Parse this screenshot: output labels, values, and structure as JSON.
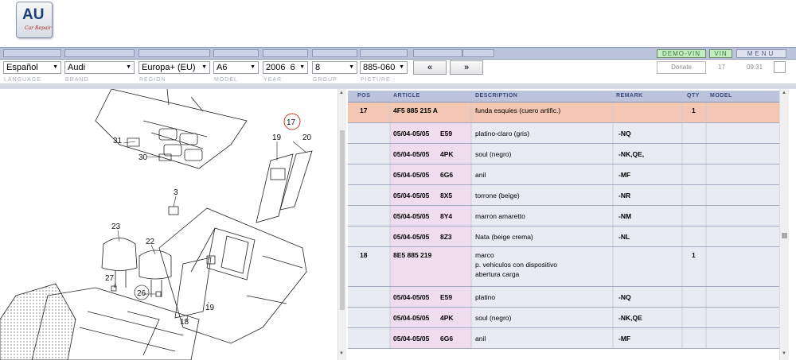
{
  "logo": {
    "big": "AU",
    "small": "Car Repair"
  },
  "topbar": {
    "demo_vin": "DEMO-VIN",
    "vin": "VIN",
    "menu": "MENU"
  },
  "filters": {
    "language": "Español",
    "brand": "Audi",
    "region": "Europa+ (EU)",
    "model": "A6",
    "year": "2006  6",
    "group": "8",
    "picture": "885-060",
    "prev": "«",
    "next": "»",
    "donate": "Donate",
    "page_current": "17",
    "page_time": "09:31"
  },
  "labels": {
    "language": "LANGUAGE",
    "brand": "BRAND",
    "region": "REGION",
    "model": "MODEL",
    "year": "YEAR",
    "group": "GROUP",
    "picture": "PICTURE"
  },
  "diagram": {
    "callouts": [
      "31",
      "30",
      "3",
      "23",
      "22",
      "27",
      "26",
      "18",
      "19",
      "20",
      "17",
      "19"
    ]
  },
  "table": {
    "headers": {
      "pos": "POS",
      "article": "ARTICLE",
      "description": "DESCRIPTION",
      "remark": "REMARK",
      "qty": "QTY",
      "model": "MODEL"
    },
    "rows": [
      {
        "pos": "17",
        "date": "",
        "article": "4F5 885 215 A",
        "lines": [
          "funda esquies (cuero artific.)"
        ],
        "remark": "",
        "qty": "1",
        "hl": true
      },
      {
        "pos": "",
        "date": "05/04-05/05",
        "article": "E59",
        "lines": [
          "platino-claro (gris)"
        ],
        "remark": "-NQ",
        "qty": ""
      },
      {
        "pos": "",
        "date": "05/04-05/05",
        "article": "4PK",
        "lines": [
          "soul (negro)"
        ],
        "remark": "-NK,QE,",
        "qty": ""
      },
      {
        "pos": "",
        "date": "05/04-05/05",
        "article": "6G6",
        "lines": [
          "anil"
        ],
        "remark": "-MF",
        "qty": ""
      },
      {
        "pos": "",
        "date": "05/04-05/05",
        "article": "8X5",
        "lines": [
          "torrone (beige)"
        ],
        "remark": "-NR",
        "qty": ""
      },
      {
        "pos": "",
        "date": "05/04-05/05",
        "article": "8Y4",
        "lines": [
          "marron amaretto"
        ],
        "remark": "-NM",
        "qty": ""
      },
      {
        "pos": "",
        "date": "05/04-05/05",
        "article": "8Z3",
        "lines": [
          "Nata (beige crema)"
        ],
        "remark": "-NL",
        "qty": ""
      },
      {
        "pos": "18",
        "date": "",
        "article": "8E5 885 219",
        "lines": [
          "marco",
          "p. vehiculos con dispositivo",
          "abertura carga"
        ],
        "remark": "",
        "qty": "1"
      },
      {
        "pos": "",
        "date": "05/04-05/05",
        "article": "E59",
        "lines": [
          "platino"
        ],
        "remark": "-NQ",
        "qty": ""
      },
      {
        "pos": "",
        "date": "05/04-05/05",
        "article": "4PK",
        "lines": [
          "soul (negro)"
        ],
        "remark": "-NK,QE",
        "qty": ""
      },
      {
        "pos": "",
        "date": "05/04-05/05",
        "article": "6G6",
        "lines": [
          "anil"
        ],
        "remark": "-MF",
        "qty": ""
      }
    ]
  }
}
